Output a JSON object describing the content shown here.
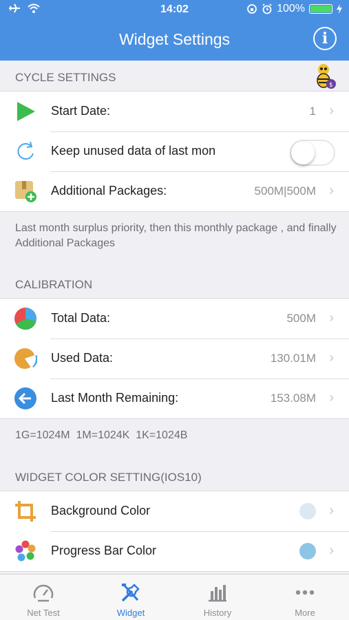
{
  "status_bar": {
    "time": "14:02",
    "battery": "100%"
  },
  "nav": {
    "title": "Widget Settings"
  },
  "cycle": {
    "header": "CYCLE SETTINGS",
    "start_date_label": "Start Date:",
    "start_date_value": "1",
    "keep_unused_label": "Keep unused data of last mon",
    "keep_unused_on": false,
    "additional_label": "Additional Packages:",
    "additional_value": "500M|500M",
    "note": "Last month surplus priority, then this monthly package , and finally Additional Packages"
  },
  "calibration": {
    "header": "CALIBRATION",
    "total_label": "Total Data:",
    "total_value": "500M",
    "used_label": "Used Data:",
    "used_value": "130.01M",
    "remaining_label": "Last Month Remaining:",
    "remaining_value": "153.08M",
    "note": "1G=1024M  1M=1024K  1K=1024B"
  },
  "widget_color": {
    "header": "WIDGET COLOR SETTING(IOS10)",
    "background_label": "Background Color",
    "background_color": "#dde8f4",
    "progress_label": "Progress Bar Color",
    "progress_color": "#8ec5e6"
  },
  "tabs": [
    {
      "label": "Net Test",
      "icon": "speedometer-icon"
    },
    {
      "label": "Widget",
      "icon": "tools-icon"
    },
    {
      "label": "History",
      "icon": "bar-chart-icon"
    },
    {
      "label": "More",
      "icon": "more-dots-icon"
    }
  ],
  "colors": {
    "accent": "#4a90e2",
    "active_tab": "#2f7de1"
  }
}
